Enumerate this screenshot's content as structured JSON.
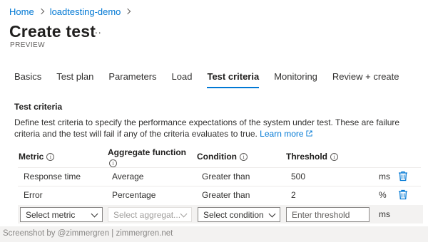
{
  "breadcrumb": {
    "items": [
      "Home",
      "loadtesting-demo"
    ]
  },
  "page": {
    "title": "Create test",
    "more": "...",
    "badge": "PREVIEW"
  },
  "tabs": [
    {
      "label": "Basics",
      "active": false
    },
    {
      "label": "Test plan",
      "active": false
    },
    {
      "label": "Parameters",
      "active": false
    },
    {
      "label": "Load",
      "active": false
    },
    {
      "label": "Test criteria",
      "active": true
    },
    {
      "label": "Monitoring",
      "active": false
    },
    {
      "label": "Review + create",
      "active": false
    }
  ],
  "section": {
    "title": "Test criteria",
    "description": "Define test criteria to specify the performance expectations of the system under test. These are failure criteria and the test will fail if any of the criteria evaluates to true.",
    "learn_more": "Learn more"
  },
  "table": {
    "headers": {
      "metric": "Metric",
      "aggregate_line1": "Aggregate function",
      "condition": "Condition",
      "threshold": "Threshold"
    },
    "info_glyph": "i",
    "rows": [
      {
        "metric": "Response time",
        "aggregate": "Average",
        "condition": "Greater than",
        "threshold": "500",
        "unit": "ms"
      },
      {
        "metric": "Error",
        "aggregate": "Percentage",
        "condition": "Greater than",
        "threshold": "2",
        "unit": "%"
      }
    ],
    "new_row": {
      "metric_placeholder": "Select metric",
      "aggregate_placeholder": "Select aggregat...",
      "condition_placeholder": "Select condition",
      "threshold_placeholder": "Enter threshold",
      "unit": "ms"
    }
  },
  "footer": {
    "text": "Screenshot by @zimmergren | zimmergren.net"
  },
  "colors": {
    "accent": "#0078d4",
    "text": "#323130",
    "muted": "#605e5c",
    "row_bg": "#f3f2f1"
  }
}
